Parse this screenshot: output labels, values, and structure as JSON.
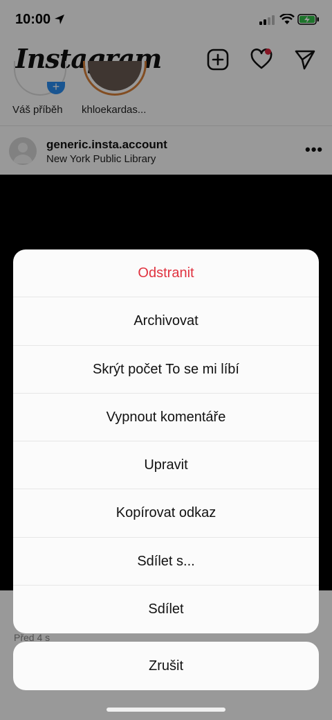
{
  "status_bar": {
    "time": "10:00"
  },
  "header": {
    "logo_text": "Instagram",
    "icons": [
      "new-post-icon",
      "activity-heart-icon",
      "direct-send-icon"
    ],
    "accent": "#e0243c"
  },
  "stories": [
    {
      "label": "Váš příběh"
    },
    {
      "label": "khloekardas..."
    }
  ],
  "post": {
    "username": "generic.insta.account",
    "location": "New York Public Library",
    "time_ago": "Před 4 s"
  },
  "action_sheet": {
    "items": [
      {
        "label": "Odstranit",
        "destructive": true
      },
      {
        "label": "Archivovat"
      },
      {
        "label": "Skrýt počet To se mi líbí"
      },
      {
        "label": "Vypnout komentáře"
      },
      {
        "label": "Upravit"
      },
      {
        "label": "Kopírovat odkaz"
      },
      {
        "label": "Sdílet s..."
      },
      {
        "label": "Sdílet"
      }
    ],
    "cancel_label": "Zrušit",
    "destructive_color": "#e0323f"
  }
}
